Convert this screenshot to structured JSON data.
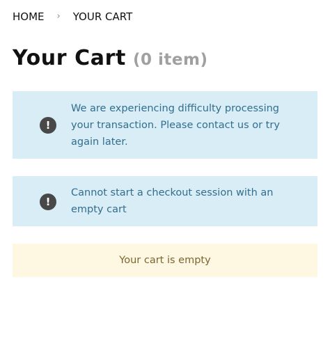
{
  "breadcrumb": {
    "home": "HOME",
    "separator": "›",
    "current": "YOUR CART"
  },
  "header": {
    "title": "Your Cart",
    "count": "(0 item)"
  },
  "alerts": [
    {
      "icon": "exclamation-circle-icon",
      "text": "We are experiencing difficulty processing your transaction. Please contact us or try again later."
    },
    {
      "icon": "exclamation-circle-icon",
      "text": "Cannot start a checkout session with an empty cart"
    }
  ],
  "empty_notice": "Your cart is empty",
  "colors": {
    "info_bg": "#d9edf6",
    "info_text": "#326e8e",
    "warn_bg": "#fef7e1",
    "warn_text": "#7b6632"
  }
}
